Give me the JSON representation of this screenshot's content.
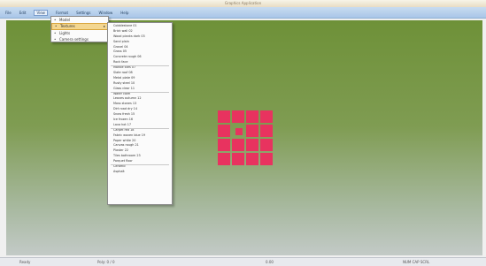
{
  "window": {
    "title": "Graphics Application"
  },
  "menubar": {
    "items": [
      "File",
      "Edit",
      "View",
      "Format",
      "Settings",
      "Window",
      "Help"
    ]
  },
  "dropdown_main": {
    "items": [
      {
        "label": "Model",
        "highlighted": false,
        "has_submenu": false
      },
      {
        "label": "Textures",
        "highlighted": true,
        "has_submenu": true
      },
      {
        "label": "Lights",
        "highlighted": false,
        "has_submenu": false
      },
      {
        "label": "Camera settings",
        "highlighted": false,
        "has_submenu": false
      }
    ]
  },
  "dropdown_sub": {
    "items": [
      "Cobblestone 01",
      "Brick wall 02",
      "Wood planks dark 03",
      "Sand plain",
      "Gravel 04",
      "Grass 05",
      "Concrete rough 06",
      "Rock face",
      "Marble tiles 07",
      "Slate roof 08",
      "Metal plate 09",
      "Rusty steel 10",
      "Glass clear 11",
      "Water calm",
      "Leaves autumn 12",
      "Moss stones 13",
      "Dirt road dry 14",
      "Snow fresh 15",
      "Ice frozen 16",
      "Lava hot 17",
      "Carpet red 18",
      "Fabric woven blue 19",
      "Paper white 20",
      "Canvas rough 21",
      "Plaster 22",
      "Tiles bathroom 23",
      "Parquet floor",
      "Ceramic",
      "Asphalt"
    ]
  },
  "statusbar": {
    "left": "Ready",
    "middle": "Poly: 0 / 0",
    "center": "0.00",
    "right": "NUM  CAP  SCRL"
  },
  "logo": {
    "color": "#e8335f"
  },
  "colors": {
    "menubar": "#a9c6e8",
    "viewport_top": "#6e9138",
    "viewport_bottom": "#c3cac7",
    "highlight": "#f3d690"
  }
}
